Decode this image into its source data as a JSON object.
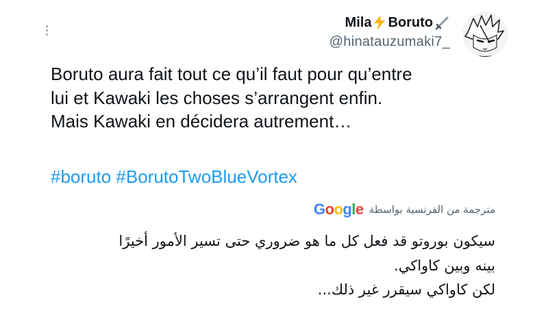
{
  "author": {
    "display_name": "Mila",
    "display_name_suffix": "Boruto",
    "handle": "@hinatauzumaki7_"
  },
  "icons": {
    "more": "more-options-icon",
    "lightning": "lightning-emoji-icon",
    "sword": "sword-emoji-icon",
    "avatar": "profile-avatar-icon",
    "google": "google-logo-icon"
  },
  "tweet": {
    "text": "Boruto aura fait tout ce qu’il faut pour qu’entre\nlui et Kawaki les choses s’arrangent enfin.\nMais Kawaki en décidera autrement…",
    "hashtags": [
      "#boruto",
      "#BorutoTwoBlueVortex"
    ]
  },
  "translation": {
    "label": "مترجمة من الفرنسية بواسطة",
    "provider": "Google",
    "lines": [
      "سيكون بوروتو قد فعل كل ما هو ضروري حتى تسير الأمور أخيرًا",
      "بينه وبين كاواكي.",
      "لكن كاواكي سيقرر غير ذلك..."
    ]
  },
  "colors": {
    "link": "#1d9bf0",
    "secondary_text": "#536471",
    "primary_text": "#0f1419",
    "google_blue": "#4285F4",
    "google_red": "#EA4335",
    "google_yellow": "#FBBC05",
    "google_green": "#34A853"
  }
}
